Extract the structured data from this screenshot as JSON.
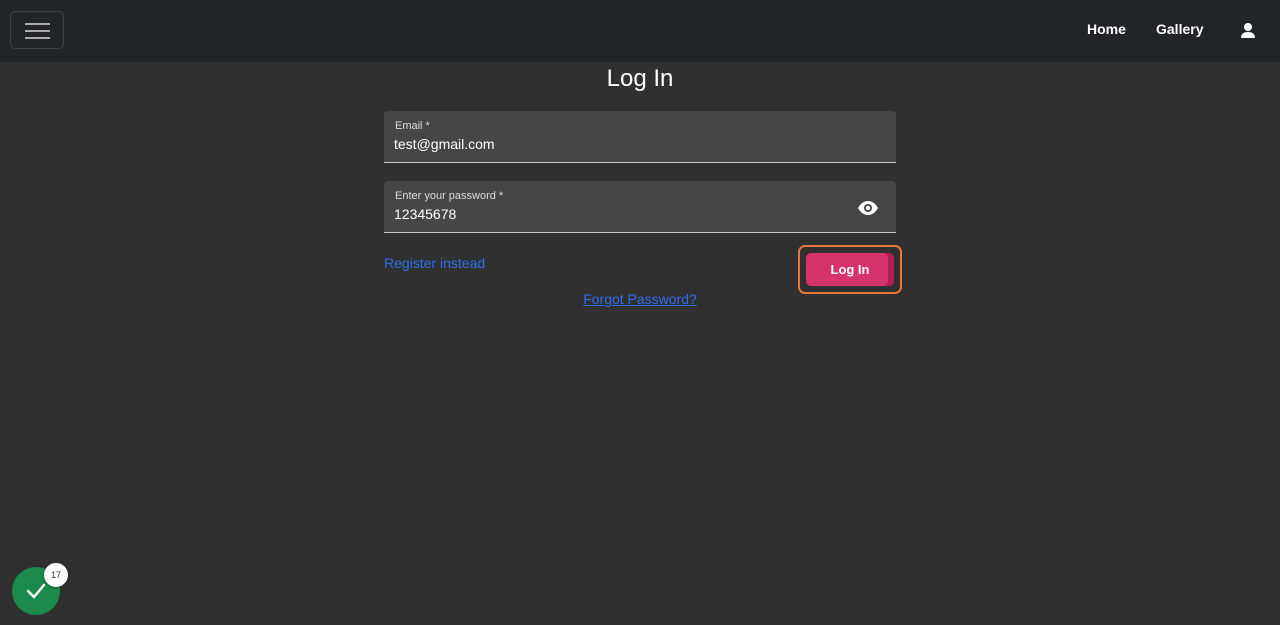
{
  "navbar": {
    "links": [
      {
        "label": "Home"
      },
      {
        "label": "Gallery"
      }
    ]
  },
  "page": {
    "title": "Log In"
  },
  "form": {
    "email": {
      "label": "Email *",
      "value": "test@gmail.com"
    },
    "password": {
      "label": "Enter your password *",
      "value": "12345678"
    },
    "register_label": "Register instead",
    "submit_label": "Log In",
    "forgot_label": "Forgot Password?"
  },
  "status": {
    "badge_count": "17",
    "color": "#1b8a4c"
  },
  "colors": {
    "accent": "#d6336c",
    "link": "#2f6df0",
    "focus_ring": "#e8763c"
  },
  "icons": {
    "menu": "hamburger-icon",
    "user": "user-icon",
    "visibility": "eye-icon",
    "status": "check-icon"
  }
}
